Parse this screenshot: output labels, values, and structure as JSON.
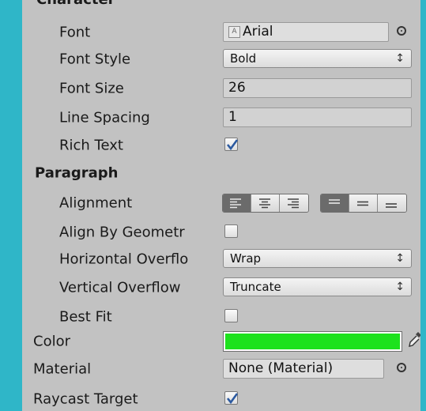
{
  "sections": {
    "character": "Character",
    "paragraph": "Paragraph"
  },
  "character": {
    "font": {
      "label": "Font",
      "value": "Arial",
      "icon": "font-asset-icon"
    },
    "font_style": {
      "label": "Font Style",
      "value": "Bold"
    },
    "font_size": {
      "label": "Font Size",
      "value": "26"
    },
    "line_spacing": {
      "label": "Line Spacing",
      "value": "1"
    },
    "rich_text": {
      "label": "Rich Text",
      "checked": true
    }
  },
  "paragraph": {
    "alignment": {
      "label": "Alignment",
      "horizontal": [
        "align-left",
        "align-center",
        "align-right"
      ],
      "vertical": [
        "align-top",
        "align-middle",
        "align-bottom"
      ],
      "selected_horizontal": "align-left",
      "selected_vertical": "align-top"
    },
    "align_by_geometry": {
      "label": "Align By Geometr",
      "checked": false
    },
    "horizontal_overflow": {
      "label": "Horizontal Overflo",
      "value": "Wrap"
    },
    "vertical_overflow": {
      "label": "Vertical Overflow",
      "value": "Truncate"
    },
    "best_fit": {
      "label": "Best Fit",
      "checked": false
    }
  },
  "color": {
    "label": "Color",
    "value": "#1de21d"
  },
  "material": {
    "label": "Material",
    "value": "None (Material)"
  },
  "raycast_target": {
    "label": "Raycast Target",
    "checked": true
  },
  "dropdown_arrow": "↑↓"
}
